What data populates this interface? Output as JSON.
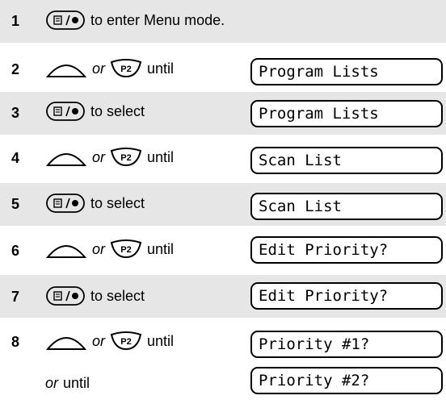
{
  "steps": [
    {
      "num": "1",
      "text": "to enter Menu mode.",
      "kind": "menu",
      "display": ""
    },
    {
      "num": "2",
      "or": "or",
      "text": "until",
      "kind": "nav",
      "display": "Program Lists"
    },
    {
      "num": "3",
      "text": "to select",
      "kind": "menu",
      "display": "Program Lists"
    },
    {
      "num": "4",
      "or": "or",
      "text": "until",
      "kind": "nav",
      "display": "Scan List"
    },
    {
      "num": "5",
      "text": "to select",
      "kind": "menu",
      "display": "Scan List"
    },
    {
      "num": "6",
      "or": "or",
      "text": "until",
      "kind": "nav",
      "display": "Edit Priority?"
    },
    {
      "num": "7",
      "text": "to select",
      "kind": "menu",
      "display": "Edit Priority?"
    },
    {
      "num": "8",
      "or": "or",
      "text": "until",
      "kind": "nav",
      "display": "Priority #1?"
    },
    {
      "num": "",
      "or": "or",
      "text": "until",
      "kind": "text",
      "display": "Priority #2?"
    }
  ],
  "icons": {
    "menu": "menu-ok-button-icon",
    "nav": "up-navigation-button-icon",
    "p2": "p2-button-icon"
  },
  "p2_label": "P2",
  "colors": {
    "shade": "#e6e6e6"
  }
}
